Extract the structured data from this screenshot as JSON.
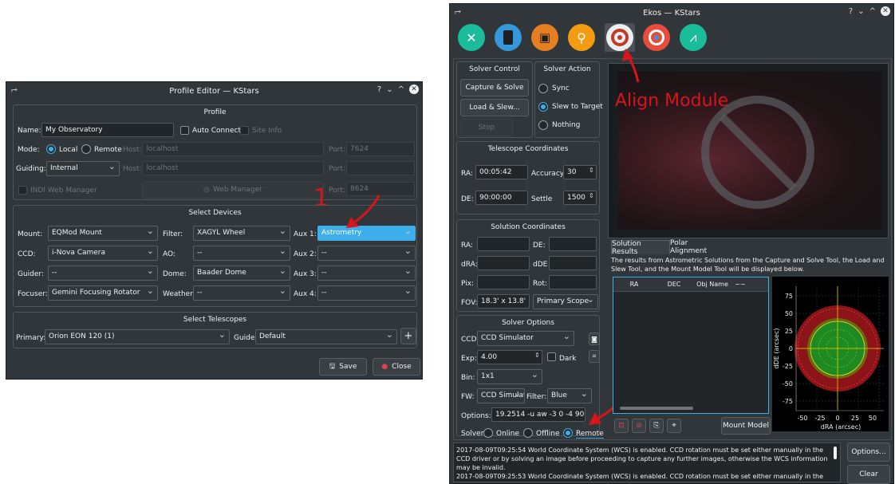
{
  "profile_editor": {
    "title": "Profile Editor — KStars",
    "titlebar_buttons": [
      "?",
      "⌄",
      "^",
      "✕"
    ],
    "profile_group": "Profile",
    "name_label": "Name:",
    "name_value": "My Observatory",
    "auto_connect": "Auto Connect",
    "site_info": "Site Info",
    "mode_label": "Mode:",
    "mode_local": "Local",
    "mode_remote": "Remote",
    "host_label": "Host:",
    "host_value": "localhost",
    "port_label": "Port:",
    "port_value": "7624",
    "guiding_label": "Guiding:",
    "guiding_value": "Internal",
    "guiding_host_label": "Host:",
    "guiding_host_value": "localhost",
    "guiding_port_label": "Port:",
    "indi_web_manager": "INDI Web Manager",
    "web_manager": "Web Manager",
    "wm_port_label": "Port:",
    "wm_port_value": "8624",
    "select_devices": "Select Devices",
    "mount_label": "Mount:",
    "mount_value": "EQMod Mount",
    "filter_label": "Filter:",
    "filter_value": "XAGYL Wheel",
    "aux1_label": "Aux 1:",
    "aux1_value": "Astrometry",
    "ccd_label": "CCD:",
    "ccd_value": "i-Nova Camera",
    "ao_label": "AO:",
    "ao_value": "--",
    "aux2_label": "Aux 2:",
    "aux2_value": "--",
    "guider_label": "Guider:",
    "guider_value": "--",
    "dome_label": "Dome:",
    "dome_value": "Baader Dome",
    "aux3_label": "Aux 3:",
    "aux3_value": "--",
    "focuser_label": "Focuser:",
    "focuser_value": "Gemini Focusing Rotator",
    "weather_label": "Weather:",
    "weather_value": "--",
    "aux4_label": "Aux 4:",
    "aux4_value": "--",
    "select_telescopes": "Select Telescopes",
    "primary_label": "Primary:",
    "primary_value": "Orion EON 120 (1)",
    "guide_label": "Guide:",
    "guide_value": "Default",
    "plus": "+",
    "save": "Save",
    "close": "Close",
    "annotation": "1"
  },
  "ekos": {
    "title": "Ekos — KStars",
    "titlebar_buttons": [
      "?",
      "⌄",
      "^",
      "✕"
    ],
    "module_icons": [
      "setup-icon",
      "scheduler-icon",
      "capture-icon",
      "focus-icon",
      "align-icon",
      "guide-icon",
      "mount-icon"
    ],
    "solver_control": "Solver Control",
    "capture_solve": "Capture & Solve",
    "load_slew": "Load & Slew...",
    "stop": "Stop",
    "solver_action": "Solver Action",
    "sync": "Sync",
    "slew_to_target": "Slew to Target",
    "nothing": "Nothing",
    "telescope_coords": "Telescope Coordinates",
    "ra_label": "RA:",
    "ra_value": "00:05:42",
    "accuracy_label": "Accuracy",
    "accuracy_value": "30",
    "de_label": "DE:",
    "de_value": "90:00:00",
    "settle_label": "Settle",
    "settle_value": "1500",
    "solution_coords": "Solution Coordinates",
    "sol_ra": "RA:",
    "sol_de": "DE:",
    "sol_dra": "dRA:",
    "sol_dde": "dDE",
    "sol_pix": "Pix:",
    "sol_rot": "Rot:",
    "fov_label": "FOV:",
    "fov_value": "18.3' x 13.8'",
    "scope_value": "Primary Scope",
    "solver_options": "Solver Options",
    "ccd_label": "CCD:",
    "ccd_value": "CCD Simulator",
    "exp_label": "Exp:",
    "exp_value": "4.00",
    "dark": "Dark",
    "bin_label": "Bin:",
    "bin_value": "1x1",
    "fw_label": "FW:",
    "fw_value": "CCD Simulat",
    "filter_label": "Filter:",
    "filter_value": "Blue",
    "options_label": "Options:",
    "options_value": "19.2514 -u aw -3 0 -4 90 -5 30",
    "solver_label": "Solver:",
    "online": "Online",
    "offline": "Offline",
    "remote": "Remote",
    "align_module": "Align Module",
    "tab_solution": "Solution Results",
    "tab_polar": "Polar Alignment",
    "results_text": "The results from Astrometric Solutions from the Capture and Solve Tool, the Load and Slew Tool, and the Mount Model Tool will be displayed below.",
    "col_ra": "RA",
    "col_dec": "DEC",
    "col_obj": "Obj Name",
    "col_extra": "~~",
    "mount_model": "Mount Model",
    "y_ticks": [
      "75",
      "50",
      "25",
      "0",
      "-25",
      "-50",
      "-75"
    ],
    "x_ticks": [
      "-50",
      "-25",
      "0",
      "25",
      "50"
    ],
    "y_axis": "dDE (arcsec)",
    "x_axis": "dRA (arcsec)",
    "log_line1": "2017-08-09T09:25:54 World Coordinate System (WCS) is enabled. CCD rotation must be set either manually in the CCD driver or by solving an image before proceeding to capture any further images, otherwise the WCS information may be invalid.",
    "log_line2": "2017-08-09T09:25:53 World Coordinate System (WCS) is enabled. CCD rotation must be set either manually in the CCD",
    "options_btn": "Options...",
    "clear_btn": "Clear",
    "annotation": "2"
  },
  "colors": {
    "bg": "#31363b",
    "accent": "#3daee9",
    "annotation": "#d8141c"
  }
}
